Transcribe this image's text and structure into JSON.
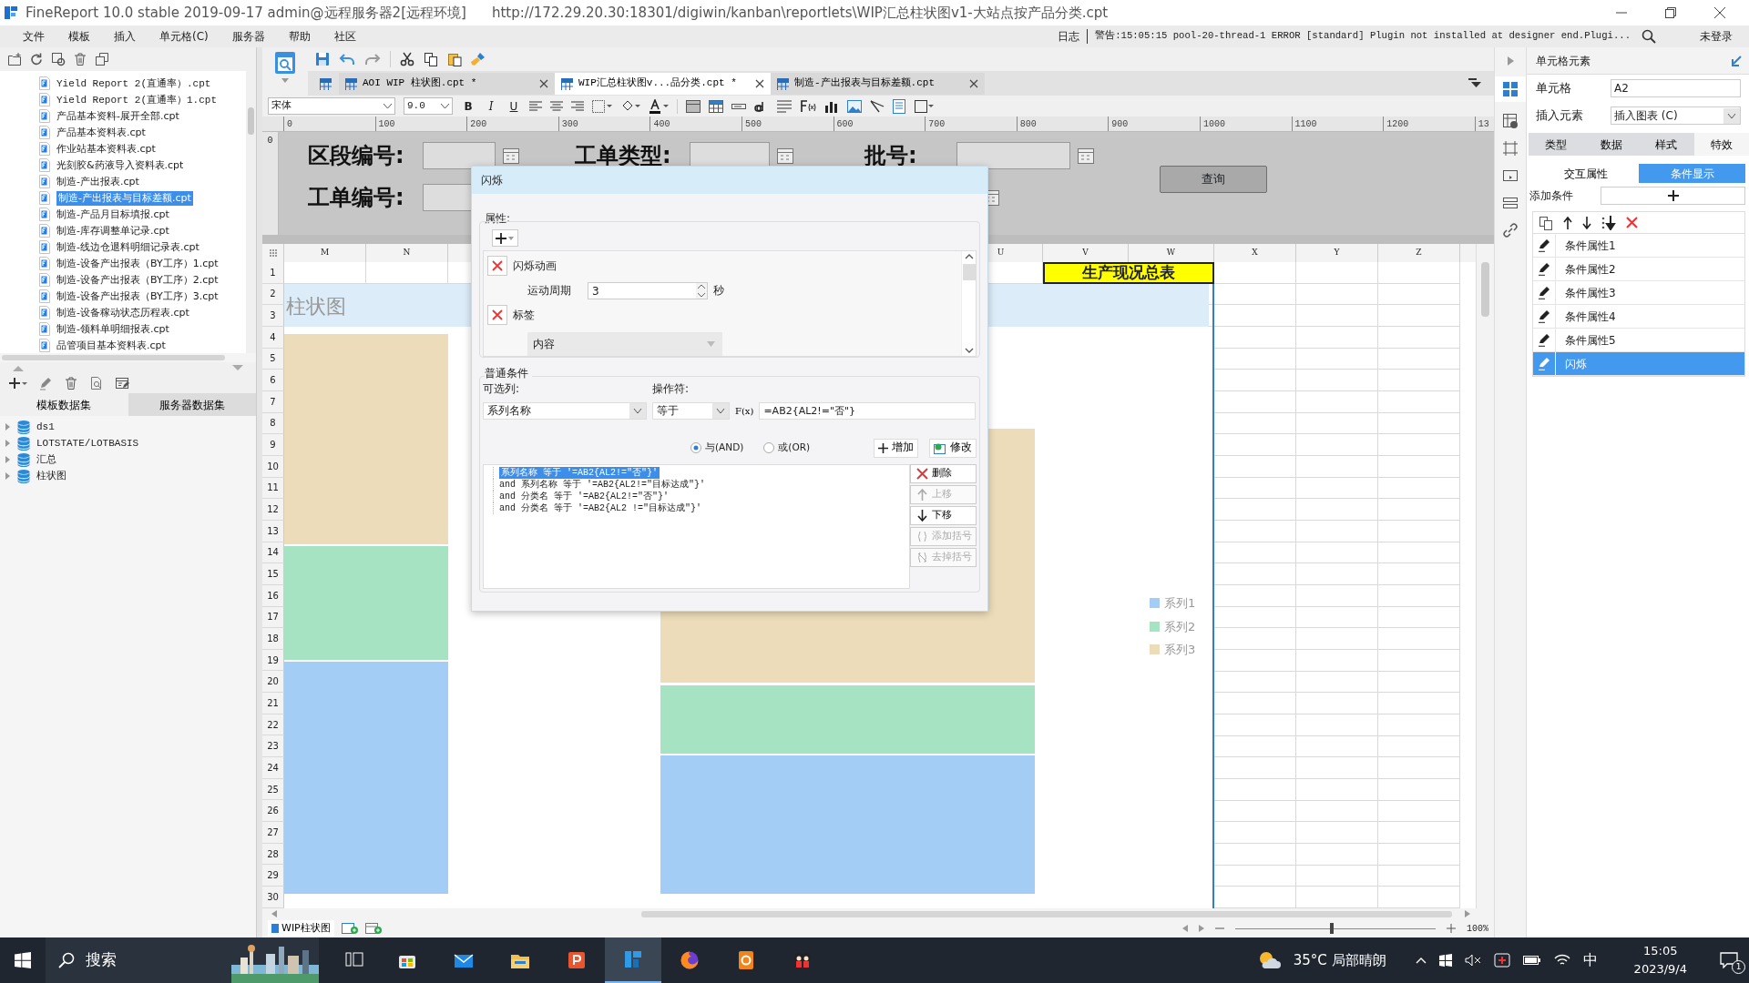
{
  "window": {
    "title": "FineReport 10.0 stable 2019-09-17 admin@远程服务器2[远程环境]",
    "address": "http://172.29.20.30:18301/digiwin/kanban\\reportlets\\WIP汇总柱状图v1-大站点按产品分类.cpt"
  },
  "menu": [
    {
      "label": "文件"
    },
    {
      "label": "模板"
    },
    {
      "label": "插入"
    },
    {
      "label": "单元格(C)"
    },
    {
      "label": "服务器"
    },
    {
      "label": "帮助"
    },
    {
      "label": "社区"
    }
  ],
  "log_bar": {
    "label": "日志",
    "message": "警告:15:05:15 pool-20-thread-1 ERROR [standard] Plugin not installed at designer end.Plugi...",
    "user": "未登录"
  },
  "file_tree": [
    {
      "label": "Yield Report 2(直通率）.cpt",
      "selected": false
    },
    {
      "label": "Yield Report 2(直通率）1.cpt",
      "selected": false
    },
    {
      "label": "产品基本资料-展开全部.cpt",
      "selected": false
    },
    {
      "label": "产品基本资料表.cpt",
      "selected": false
    },
    {
      "label": "作业站基本资料表.cpt",
      "selected": false
    },
    {
      "label": "光刻胶&药液导入资料表.cpt",
      "selected": false
    },
    {
      "label": "制造-产出报表.cpt",
      "selected": false
    },
    {
      "label": "制造-产出报表与目标差额.cpt",
      "selected": true
    },
    {
      "label": "制造-产品月目标填报.cpt",
      "selected": false
    },
    {
      "label": "制造-库存调整单记录.cpt",
      "selected": false
    },
    {
      "label": "制造-线边仓退料明细记录表.cpt",
      "selected": false
    },
    {
      "label": "制造-设备产出报表（BY工序）1.cpt",
      "selected": false
    },
    {
      "label": "制造-设备产出报表（BY工序）2.cpt",
      "selected": false
    },
    {
      "label": "制造-设备产出报表（BY工序）3.cpt",
      "selected": false
    },
    {
      "label": "制造-设备稼动状态历程表.cpt",
      "selected": false
    },
    {
      "label": "制造-领料单明细报表.cpt",
      "selected": false
    },
    {
      "label": "品管项目基本资料表.cpt",
      "selected": false
    }
  ],
  "dataset_tabs": [
    {
      "label": "模板数据集",
      "selected": true
    },
    {
      "label": "服务器数据集",
      "selected": false
    }
  ],
  "datasets": [
    {
      "label": "ds1",
      "expanded": false
    },
    {
      "label": "LOTSTATE/LOTBASIS",
      "expanded": false
    },
    {
      "label": "汇总",
      "expanded": false
    },
    {
      "label": "柱状图",
      "expanded": false
    }
  ],
  "editor_tabs": [
    {
      "label": "AOI WIP 柱状图.cpt *",
      "selected": false
    },
    {
      "label": "WIP汇总柱状图v...品分类.cpt *",
      "selected": true
    },
    {
      "label": "制造-产出报表与目标差额.cpt",
      "selected": false
    }
  ],
  "format_bar": {
    "font": "宋体",
    "size": "9.0",
    "style_buttons": [
      "B",
      "I",
      "U"
    ]
  },
  "ruler": [
    "0",
    "100",
    "200",
    "300",
    "400",
    "500",
    "600",
    "700",
    "800",
    "900",
    "1000",
    "1100",
    "1200",
    "13"
  ],
  "vertical_ruler": [
    "0"
  ],
  "parameters": [
    [
      {
        "label": "区段编号:"
      },
      {
        "label": "工单类型:"
      },
      {
        "label": "批号:"
      }
    ],
    [
      {
        "label": "工单编号:"
      }
    ]
  ],
  "query_button": "查询",
  "sheet": {
    "columns": [
      "M",
      "N",
      "U",
      "V",
      "W",
      "X",
      "Y",
      "Z"
    ],
    "rows": [
      "1",
      "2",
      "3",
      "4",
      "5",
      "6",
      "7",
      "8",
      "9",
      "10",
      "11",
      "12",
      "13",
      "14",
      "15",
      "16",
      "17",
      "18",
      "19",
      "20",
      "21",
      "22",
      "23",
      "24",
      "25",
      "26",
      "27",
      "28",
      "29",
      "30"
    ],
    "title_cell": "生产现况总表",
    "chart_title": "柱状图",
    "legend": [
      {
        "label": "系列1",
        "color": "#a3cdf5"
      },
      {
        "label": "系列2",
        "color": "#a6e3c2"
      },
      {
        "label": "系列3",
        "color": "#ecdcb9"
      }
    ]
  },
  "sheet_tabs": [
    {
      "label": "WIP柱状图",
      "selected": true
    }
  ],
  "zoom": {
    "label": "100%",
    "level": 0.48
  },
  "dialog": {
    "title": "闪烁",
    "properties_label": "属性:",
    "properties": [
      {
        "kind": "animation",
        "label": "闪烁动画",
        "period_label": "运动周期",
        "period": "3",
        "unit": "秒"
      },
      {
        "kind": "label",
        "label": "标签",
        "content": "内容"
      }
    ],
    "conditions_label": "普通条件",
    "column_label": "可选列:",
    "column": "系列名称",
    "operator_label": "操作符:",
    "operator": "等于",
    "formula_button": "F(x)",
    "formula": "=AB2{AL2!=\"否\"}",
    "logic": [
      {
        "label": "与(AND)",
        "selected": true
      },
      {
        "label": "或(OR)",
        "selected": false
      }
    ],
    "add_button": "增加",
    "modify_button": "修改",
    "conditions": [
      {
        "text": "系列名称 等于 '=AB2{AL2!=\"否\"}'",
        "selected": true
      },
      {
        "text": "and 系列名称 等于 '=AB2{AL2!=\"目标达成\"}'",
        "selected": false
      },
      {
        "text": "and 分类名 等于 '=AB2{AL2!=\"否\"}'",
        "selected": false
      },
      {
        "text": "and 分类名 等于 '=AB2{AL2 !=\"目标达成\"}'",
        "selected": false
      }
    ],
    "side_buttons": [
      {
        "kind": "delete",
        "label": "删除",
        "disabled": false
      },
      {
        "kind": "up",
        "label": "上移",
        "disabled": true
      },
      {
        "kind": "down",
        "label": "下移",
        "disabled": false
      },
      {
        "kind": "add-paren",
        "label": "添加括号",
        "disabled": true
      },
      {
        "kind": "remove-paren",
        "label": "去掉括号",
        "disabled": true
      }
    ]
  },
  "right_panel": {
    "title": "单元格元素",
    "cell_label": "单元格",
    "cell": "A2",
    "insert_label": "插入元素",
    "insert": "插入图表 (C)",
    "tabs": [
      {
        "label": "类型",
        "selected": false
      },
      {
        "label": "数据",
        "selected": false
      },
      {
        "label": "样式",
        "selected": false
      },
      {
        "label": "特效",
        "selected": true
      }
    ],
    "subtabs": [
      {
        "label": "交互属性",
        "selected": false
      },
      {
        "label": "条件显示",
        "selected": true
      }
    ],
    "add_label": "添加条件",
    "conditions": [
      {
        "label": "条件属性1",
        "selected": false
      },
      {
        "label": "条件属性2",
        "selected": false
      },
      {
        "label": "条件属性3",
        "selected": false
      },
      {
        "label": "条件属性4",
        "selected": false
      },
      {
        "label": "条件属性5",
        "selected": false
      },
      {
        "label": "闪烁",
        "selected": true
      }
    ]
  },
  "taskbar": {
    "search": "搜索",
    "apps": [
      {
        "kind": "taskview",
        "active": false
      },
      {
        "kind": "store",
        "active": false
      },
      {
        "kind": "mail",
        "active": false
      },
      {
        "kind": "files",
        "active": false
      },
      {
        "kind": "slides",
        "active": false
      },
      {
        "kind": "report",
        "active": true
      },
      {
        "kind": "browser",
        "active": false
      },
      {
        "kind": "pdf",
        "active": false
      },
      {
        "kind": "game",
        "active": false
      }
    ],
    "weather": "35°C 局部晴朗",
    "ime": "中",
    "time": "15:05",
    "date": "2023/9/4",
    "notifications": "1"
  }
}
